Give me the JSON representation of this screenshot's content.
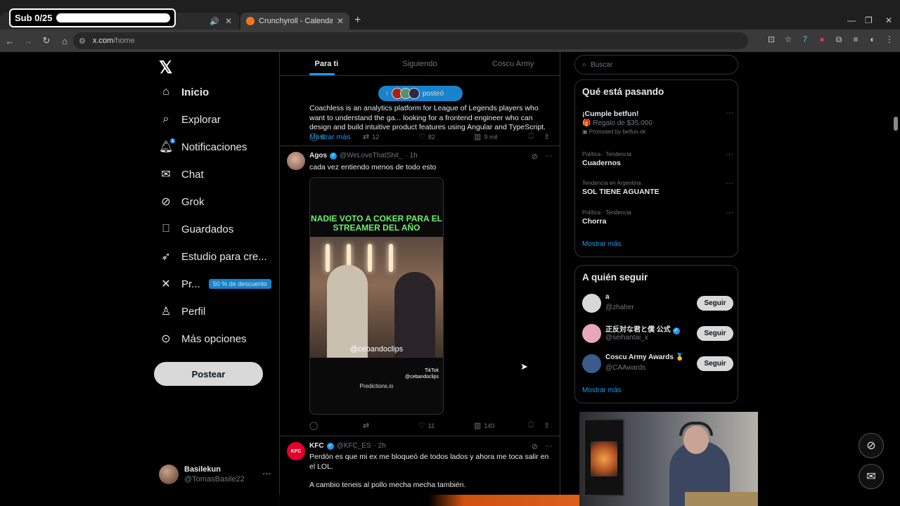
{
  "overlay": {
    "sub_counter": "Sub 0/25",
    "sub_progress": 0.0
  },
  "browser": {
    "tab_active_label": "Crunchyroll - Calendario de em",
    "url_host": "x.com",
    "url_path": "/home"
  },
  "sidebar": {
    "items": [
      {
        "label": "Inicio",
        "icon": "home-icon"
      },
      {
        "label": "Explorar",
        "icon": "search-icon"
      },
      {
        "label": "Notificaciones",
        "icon": "bell-icon",
        "badge": "1"
      },
      {
        "label": "Chat",
        "icon": "envelope-icon"
      },
      {
        "label": "Grok",
        "icon": "grok-icon"
      },
      {
        "label": "Guardados",
        "icon": "bookmark-icon"
      },
      {
        "label": "Estudio para cre...",
        "icon": "rocket-icon"
      },
      {
        "label": "Pr...",
        "icon": "x-premium-icon",
        "badge": "50 % de descuento"
      },
      {
        "label": "Perfil",
        "icon": "person-icon"
      },
      {
        "label": "Más opciones",
        "icon": "more-circle-icon"
      }
    ],
    "post_button": "Postear",
    "account": {
      "display_name": "Basilekun",
      "handle": "@TomasBasile22"
    }
  },
  "timeline": {
    "tabs": [
      "Para ti",
      "Siguiendo",
      "Coscu Army"
    ],
    "new_posts_pill": "posteó",
    "post1": {
      "text": "Coachless is an analytics platform for League of Legends players who want to understand the ga... looking for a frontend engineer who can design and build intuitive product features using Angular and TypeScript.",
      "show_more": "Mostrar más",
      "replies": "5",
      "reposts": "12",
      "likes": "82",
      "views": "9 mil"
    },
    "post2": {
      "display_name": "Agos",
      "handle": "@WeLoveThatShit_",
      "time": "· 1h",
      "text": "cada vez entiendo menos de todo esto",
      "video_caption": "NADIE VOTO A COKER PARA EL STREAMER DEL AÑO",
      "video_watermark": "@cebandoclips",
      "video_tiktok": "TikTok",
      "video_tiktok_handle": "@cebandoclips",
      "video_sponsor": "Predictions.io",
      "replies": "",
      "reposts": "",
      "likes": "11",
      "views": "140"
    },
    "post3": {
      "display_name": "KFC",
      "handle": "@KFC_ES",
      "time": "· 2h",
      "text1": "Perdón es que mi ex me bloqueó de todos lados y ahora me toca salir en el LOL.",
      "text2": "A cambio teneis al pollo mecha mecha también."
    }
  },
  "right": {
    "search_placeholder": "Buscar",
    "trends_title": "Qué está pasando",
    "trends": [
      {
        "meta": "",
        "name": "¡Cumple betfun!",
        "sub": "Regalo de $35.000",
        "promo": "Promoted by betfun.ok"
      },
      {
        "meta": "Política · Tendencia",
        "name": "Cuadernos",
        "sub": "",
        "promo": ""
      },
      {
        "meta": "Tendencia en Argentina",
        "name": "SOL TIENE AGUANTE",
        "sub": "",
        "promo": ""
      },
      {
        "meta": "Política · Tendencia",
        "name": "Chorra",
        "sub": "",
        "promo": ""
      }
    ],
    "trends_more": "Mostrar más",
    "follow_title": "A quién seguir",
    "who_to_follow": [
      {
        "name": "a",
        "handle": "@zhaher",
        "button": "Seguir",
        "color": "#d8d8d8"
      },
      {
        "name": "正反対な君と僕 公式",
        "handle": "@seihantai_x",
        "button": "Seguir",
        "color": "#e8a7b8"
      },
      {
        "name": "Coscu Army Awards 🥇",
        "handle": "@CAAwards",
        "button": "Seguir",
        "color": "#3c5a8a"
      }
    ],
    "follow_more": "Mostrar más"
  },
  "colors": {
    "accent": "#1d9bf0",
    "background": "#000000",
    "border": "#2f3336"
  }
}
